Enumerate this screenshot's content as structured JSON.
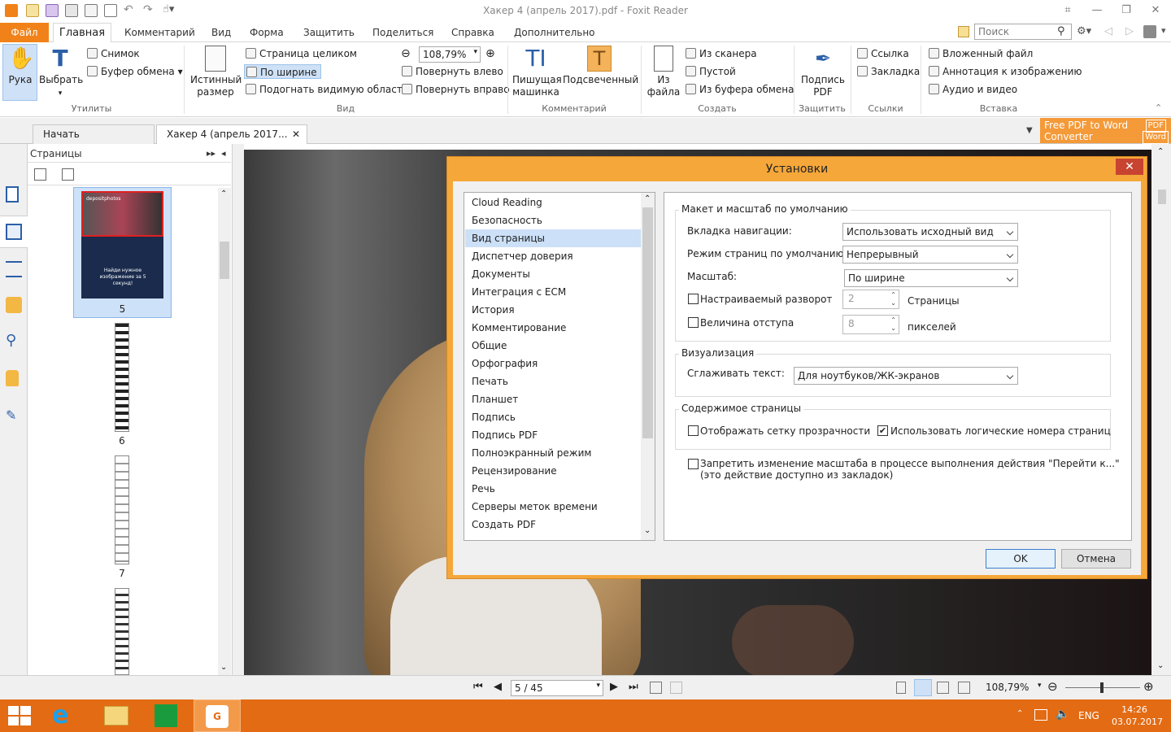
{
  "window": {
    "title": "Хакер 4 (апрель 2017).pdf - Foxit Reader"
  },
  "menu": {
    "file": "Файл",
    "home": "Главная",
    "items": [
      "Комментарий",
      "Вид",
      "Форма",
      "Защитить",
      "Поделиться",
      "Справка",
      "Дополнительно"
    ],
    "search_placeholder": "Поиск"
  },
  "ribbon": {
    "hand": "Рука",
    "select": "Выбрать",
    "snapshot": "Снимок",
    "clipboard": "Буфер обмена",
    "group_utilities": "Утилиты",
    "actual_size_1": "Истинный",
    "actual_size_2": "размер",
    "fit_page": "Страница целиком",
    "fit_width": "По ширине",
    "fit_visible": "Подогнать видимую область",
    "zoom": "108,79%",
    "rotate_left": "Повернуть влево",
    "rotate_right": "Повернуть вправо",
    "group_view": "Вид",
    "typewriter_1": "Пишущая",
    "typewriter_2": "машинка",
    "highlight": "Подсвеченный",
    "group_comment": "Комментарий",
    "from_file_1": "Из",
    "from_file_2": "файла",
    "from_scanner": "Из сканера",
    "blank": "Пустой",
    "from_clipboard": "Из буфера обмена",
    "group_create": "Создать",
    "sign_1": "Подпись",
    "sign_2": "PDF",
    "group_protect": "Защитить",
    "link": "Ссылка",
    "bookmark": "Закладка",
    "group_links": "Ссылки",
    "attach": "Вложенный файл",
    "image_annot": "Аннотация к изображению",
    "audio_video": "Аудио и видео",
    "group_insert": "Вставка"
  },
  "tabs": {
    "start": "Начать",
    "doc": "Хакер 4 (апрель 2017..."
  },
  "promo": {
    "line1": "Free PDF to Word",
    "line2": "Converter",
    "badge1": "PDF",
    "badge2": "Word"
  },
  "panel": {
    "title": "Страницы",
    "thumbs": [
      "5",
      "6",
      "7"
    ],
    "thumb_brand": "depositphotos",
    "thumb_caption": "Найди нужное изображение за 5 секунд!"
  },
  "dialog": {
    "title": "Установки",
    "close": "✕",
    "categories": [
      "Cloud Reading",
      "Безопасность",
      "Вид страницы",
      "Диспетчер доверия",
      "Документы",
      "Интеграция с ECM",
      "История",
      "Комментирование",
      "Общие",
      "Орфография",
      "Печать",
      "Планшет",
      "Подпись",
      "Подпись PDF",
      "Полноэкранный режим",
      "Рецензирование",
      "Речь",
      "Серверы меток времени",
      "Создать PDF"
    ],
    "selected_index": 2,
    "group1": "Макет и масштаб по умолчанию",
    "nav_tab_label": "Вкладка навигации:",
    "nav_tab_value": "Использовать исходный вид",
    "page_mode_label": "Режим страниц по умолчанию:",
    "page_mode_value": "Непрерывный",
    "zoom_label": "Масштаб:",
    "zoom_value": "По ширине",
    "custom_spread": "Настраиваемый разворот",
    "spread_value": "2",
    "spread_unit": "Страницы",
    "indent": "Величина отступа",
    "indent_value": "8",
    "indent_unit": "пикселей",
    "group2": "Визуализация",
    "smooth_label": "Сглаживать текст:",
    "smooth_value": "Для ноутбуков/ЖК-экранов",
    "group3": "Содержимое страницы",
    "transparency_grid": "Отображать сетку прозрачности",
    "logical_numbers": "Использовать логические номера страниц",
    "logical_checked": true,
    "prevent_zoom_1": "Запретить изменение масштаба в процессе выполнения действия \"Перейти к...\"",
    "prevent_zoom_2": "(это действие доступно из закладок)",
    "ok": "OK",
    "cancel": "Отмена"
  },
  "status": {
    "page": "5 / 45",
    "zoom": "108,79%"
  },
  "taskbar": {
    "lang": "ENG",
    "time": "14:26",
    "date": "03.07.2017"
  },
  "colors": {
    "accent": "#f08219",
    "taskbar": "#e36b13",
    "dialog_frame": "#f5a73a",
    "selection": "#cce0f7"
  }
}
